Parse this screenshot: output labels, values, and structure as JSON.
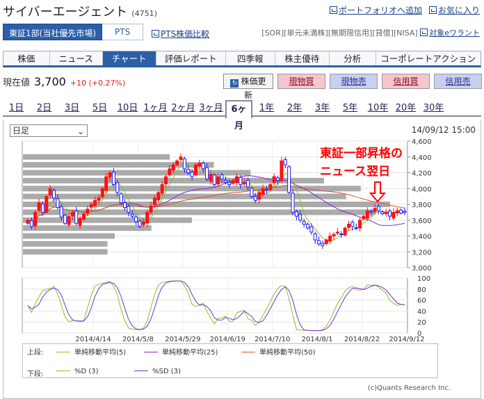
{
  "header": {
    "title": "サイバーエージェント",
    "code": "(4751)",
    "portfolio_link": "ポートフォリオへ追加",
    "watchlist_link": "お気に入り"
  },
  "market": {
    "selected": "東証1部(当社優先市場)",
    "pts": "PTS",
    "pts_compare": "PTS株価比較"
  },
  "flags": {
    "items": [
      "[SOR]",
      "[単元未満株]",
      "[無期限信用]",
      "[貸借]",
      "[NISA]"
    ],
    "target_link": "対象eワラント"
  },
  "tabs": [
    "株価",
    "ニュース",
    "チャート",
    "評価レポート",
    "四季報",
    "株主優待",
    "分析",
    "コーポレートアクション"
  ],
  "active_tab": "チャート",
  "price": {
    "label": "現在値",
    "value": "3,700",
    "change": "+10 (+0.27%)"
  },
  "buttons": {
    "update": "株価更新",
    "buy_cash": "現物買",
    "sell_cash": "現物売",
    "buy_margin": "信用買",
    "sell_margin": "信用売"
  },
  "period_tabs": [
    "1日",
    "2日",
    "3日",
    "5日",
    "10日",
    "1ヶ月",
    "2ヶ月",
    "3ヶ月",
    "6ヶ月",
    "1年",
    "2年",
    "3年",
    "5年",
    "10年",
    "20年",
    "30年"
  ],
  "active_period": "6ヶ月",
  "chart_controls": {
    "interval": "日足",
    "datetime": "14/09/12 15:00"
  },
  "annotation": {
    "line1": "東証一部昇格の",
    "line2": "ニュース翌日"
  },
  "colors": {
    "up": "#ff1111",
    "down": "#1a1aff",
    "ma5": "#8cbf26",
    "ma25": "#7b2ad6",
    "ma50": "#e0502a",
    "volprof": "#9c9c9c",
    "annotation": "#ff0000"
  },
  "chart_data": {
    "type": "candlestick",
    "price_axis": {
      "ticks": [
        "4,600",
        "4,400",
        "4,200",
        "4,000",
        "3,800",
        "3,600",
        "3,400",
        "3,200",
        "3,000"
      ],
      "ylim": [
        3000,
        4600
      ]
    },
    "osc_axis": {
      "ticks": [
        "100",
        "80",
        "60",
        "40",
        "20",
        "0"
      ],
      "ylim": [
        0,
        100
      ]
    },
    "x_tick_labels": [
      "2014/4/14",
      "2014/5/8",
      "2014/5/29",
      "2014/6/19",
      "2014/7/10",
      "2014/8/1",
      "2014/8/22",
      "2014/9/12"
    ],
    "close": [
      3600,
      3520,
      3700,
      3820,
      3700,
      3900,
      4000,
      3880,
      3760,
      3640,
      3560,
      3650,
      3700,
      3560,
      3620,
      3680,
      3740,
      3800,
      3850,
      3880,
      4000,
      4150,
      4200,
      4050,
      3950,
      3820,
      3760,
      3700,
      3650,
      3580,
      3520,
      3580,
      3700,
      3780,
      3880,
      3950,
      4050,
      4150,
      4250,
      4300,
      4350,
      4400,
      4250,
      4200,
      4150,
      4300,
      4320,
      4250,
      4120,
      4180,
      4050,
      4150,
      4120,
      4080,
      4050,
      4100,
      4150,
      4050,
      4080,
      4020,
      3900,
      3850,
      3950,
      4000,
      3980,
      4050,
      4150,
      4100,
      4350,
      4300,
      3950,
      3700,
      3650,
      3600,
      3550,
      3500,
      3450,
      3350,
      3300,
      3280,
      3350,
      3400,
      3420,
      3450,
      3420,
      3500,
      3550,
      3520,
      3500,
      3600,
      3650,
      3720,
      3700,
      3750,
      3720,
      3680,
      3700,
      3650,
      3700,
      3720,
      3690,
      3700
    ],
    "volume_profile_rows": [
      {
        "price": 4400,
        "len": 0.4
      },
      {
        "price": 4300,
        "len": 0.52
      },
      {
        "price": 4200,
        "len": 0.62
      },
      {
        "price": 4100,
        "len": 0.82
      },
      {
        "price": 4000,
        "len": 0.92
      },
      {
        "price": 3900,
        "len": 0.88
      },
      {
        "price": 3800,
        "len": 1.0
      },
      {
        "price": 3700,
        "len": 0.96
      },
      {
        "price": 3600,
        "len": 0.46
      },
      {
        "price": 3500,
        "len": 0.35
      },
      {
        "price": 3400,
        "len": 0.25
      },
      {
        "price": 3300,
        "len": 0.23
      },
      {
        "price": 3200,
        "len": 0.23
      }
    ],
    "series": [
      {
        "name": "単純移動平均(5)"
      },
      {
        "name": "単純移動平均(25)"
      },
      {
        "name": "単純移動平均(50)"
      },
      {
        "name": "%D (3)"
      },
      {
        "name": "%SD (3)"
      }
    ]
  },
  "legend": {
    "upper_label": "上段:",
    "lower_label": "下段:",
    "ma5": "単純移動平均(5)",
    "ma25": "単純移動平均(25)",
    "ma50": "単純移動平均(50)",
    "pd": "%D (3)",
    "psd": "%SD (3)"
  },
  "credit": "(c)Quants Research Inc."
}
